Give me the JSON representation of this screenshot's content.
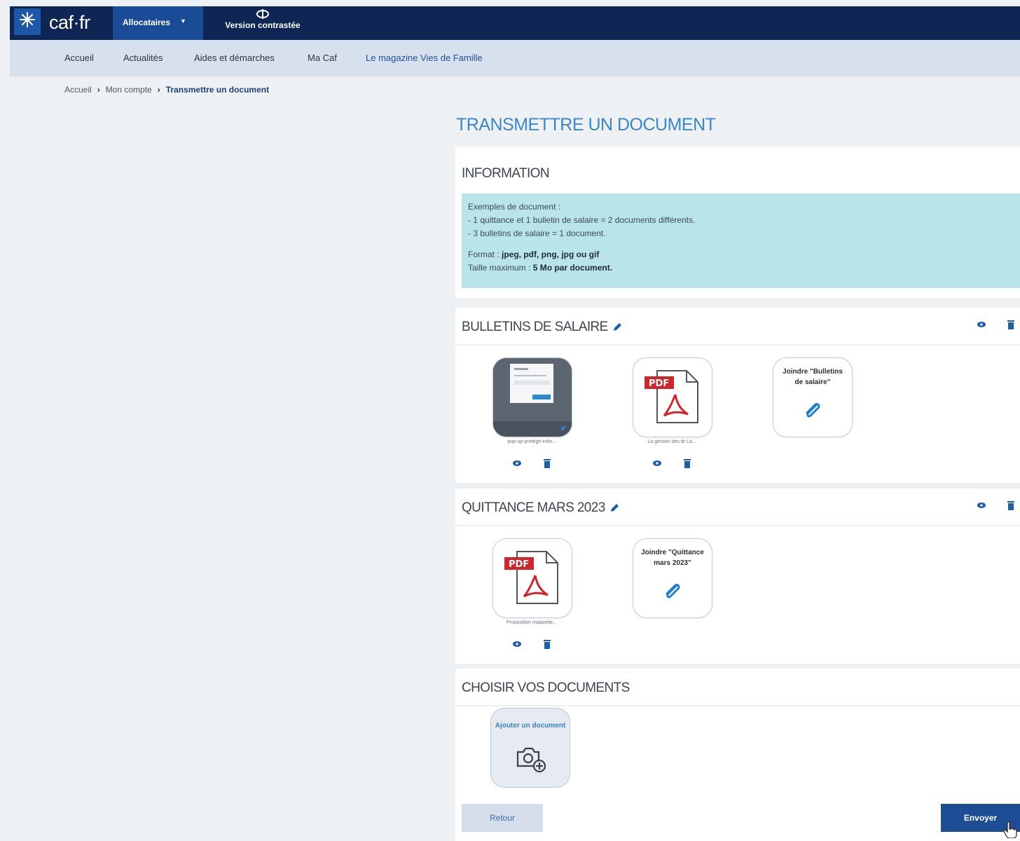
{
  "header": {
    "logo_text": "caf·fr",
    "allocataires_label": "Allocataires",
    "contrast_label": "Version contrastée"
  },
  "nav": {
    "items": [
      "Accueil",
      "Actualités",
      "Aides et démarches",
      "Ma Caf",
      "Le magazine Vies de Famille"
    ]
  },
  "breadcrumb": [
    "Accueil",
    "Mon compte",
    "Transmettre un document"
  ],
  "page_title": "TRANSMETTRE UN DOCUMENT",
  "information": {
    "title": "INFORMATION",
    "examples_heading": "Exemples de document :",
    "example_1": "- 1 quittance et 1 bulletin de salaire = 2 documents différents.",
    "example_2": "- 3 bulletins de salaire = 1 document.",
    "format_label": "Format : ",
    "format_value": "jpeg, pdf, png, jpg ou gif",
    "size_label": "Taille maximum : ",
    "size_value": "5 Mo par document."
  },
  "groups": [
    {
      "title": "BULLETINS DE SALAIRE",
      "files": [
        {
          "kind": "image",
          "caption": "pop-up-protégé-infor..."
        },
        {
          "kind": "pdf",
          "caption": "La gestion des dr La..."
        }
      ],
      "join_label": "Joindre \"Bulletins de salaire\""
    },
    {
      "title": "QUITTANCE MARS 2023",
      "files": [
        {
          "kind": "pdf",
          "caption": "Proposition maquette..."
        }
      ],
      "join_label": "Joindre \"Quittance mars 2023\""
    }
  ],
  "choose": {
    "title": "CHOISIR VOS DOCUMENTS",
    "add_label": "Ajouter un document"
  },
  "buttons": {
    "back": "Retour",
    "send": "Envoyer"
  },
  "colors": {
    "topbar": "#0f2654",
    "accent": "#1a4b97",
    "info_bg": "#b8e4ea",
    "title": "#3b86c6",
    "pdf_red": "#d2252b"
  }
}
